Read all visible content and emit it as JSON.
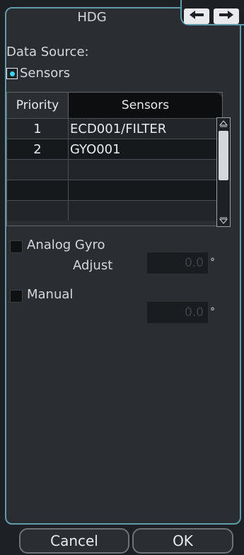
{
  "dialog": {
    "title": "HDG",
    "nav": {
      "prev_icon": "arrow-left-icon",
      "next_icon": "arrow-right-icon"
    }
  },
  "data_source": {
    "label": "Data Source:",
    "sensors_option": {
      "label": "Sensors",
      "selected": true
    }
  },
  "table": {
    "headers": {
      "priority": "Priority",
      "sensors": "Sensors"
    },
    "rows": [
      {
        "priority": "1",
        "sensor": "ECD001/FILTER"
      },
      {
        "priority": "2",
        "sensor": "GYO001"
      },
      {
        "priority": "",
        "sensor": ""
      },
      {
        "priority": "",
        "sensor": ""
      },
      {
        "priority": "",
        "sensor": ""
      }
    ]
  },
  "analog_gyro": {
    "label": "Analog Gyro",
    "checked": false,
    "adjust_label": "Adjust",
    "adjust_value": "0.0",
    "unit": "°"
  },
  "manual": {
    "label": "Manual",
    "checked": false,
    "value": "0.0",
    "unit": "°"
  },
  "buttons": {
    "cancel": "Cancel",
    "ok": "OK"
  },
  "colors": {
    "accent": "#39d7ea",
    "frame_border": "#5f9cab",
    "background": "#1d2125",
    "panel": "#2a2e32"
  }
}
